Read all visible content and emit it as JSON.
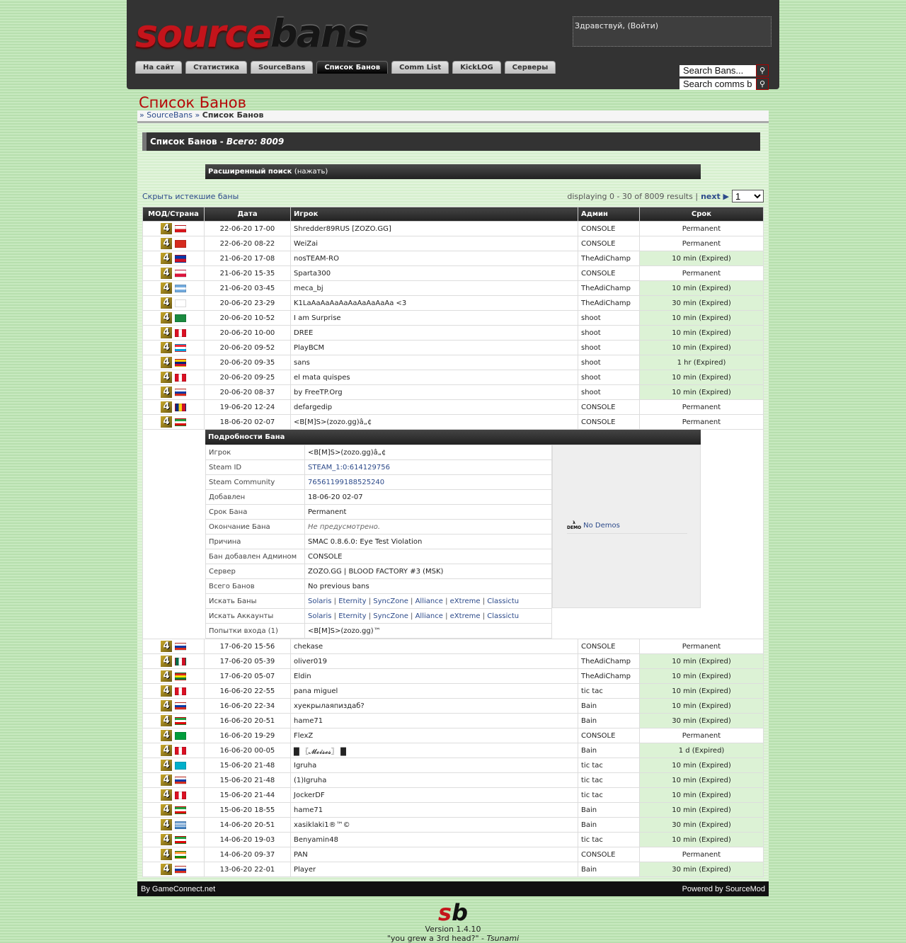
{
  "header": {
    "logo_part1": "source",
    "logo_part2": "bans",
    "welcome_text": "Здравствуй, ",
    "login_link": "(Войти)",
    "tabs": [
      {
        "label": "На сайт",
        "active": false
      },
      {
        "label": "Статистика",
        "active": false
      },
      {
        "label": "SourceBans",
        "active": false
      },
      {
        "label": "Список Банов",
        "active": true
      },
      {
        "label": "Comm List",
        "active": false
      },
      {
        "label": "KickLOG",
        "active": false
      },
      {
        "label": "Серверы",
        "active": false
      }
    ],
    "search_bans_value": "Search Bans...",
    "search_comms_value": "Search comms bans..."
  },
  "page": {
    "title": "Список Банов",
    "breadcrumb": {
      "sep": "»",
      "root": "SourceBans",
      "current": "Список Банов"
    },
    "list_title": "Список Банов - ",
    "list_total": "Всего: 8009",
    "adv_search_label": "Расширенный поиск",
    "adv_search_hint": "(нажать)",
    "hide_expired": "Скрыть истекшие баны",
    "pager_text": "displaying 0 - 30 of 8009 results |",
    "pager_next": "next ▶",
    "pager_page": "1"
  },
  "table": {
    "headers": [
      "МОД/Страна",
      "Дата",
      "Игрок",
      "Админ",
      "Срок"
    ],
    "rows_before": [
      {
        "flag": "cz",
        "date": "22-06-20 17-00",
        "player": "Shredder89RUS [ZOZO.GG]",
        "admin": "CONSOLE",
        "length": "Permanent",
        "expired": false
      },
      {
        "flag": "tw",
        "date": "22-06-20 08-22",
        "player": "WeiZai",
        "admin": "CONSOLE",
        "length": "Permanent",
        "expired": false
      },
      {
        "flag": "ph",
        "date": "21-06-20 17-08",
        "player": "nosTEAM-RO",
        "admin": "TheAdiChamp",
        "length": "10 min (Expired)",
        "expired": true
      },
      {
        "flag": "pl",
        "date": "21-06-20 15-35",
        "player": "Sparta300",
        "admin": "CONSOLE",
        "length": "Permanent",
        "expired": false
      },
      {
        "flag": "ar",
        "date": "21-06-20 03-45",
        "player": "meca_bj",
        "admin": "TheAdiChamp",
        "length": "10 min (Expired)",
        "expired": true
      },
      {
        "flag": "ge",
        "date": "20-06-20 23-29",
        "player": "K1LaAaAaAaAaAaAaAaAaAa <3",
        "admin": "TheAdiChamp",
        "length": "30 min (Expired)",
        "expired": true
      },
      {
        "flag": "tm",
        "date": "20-06-20 10-52",
        "player": "I am Surprise",
        "admin": "shoot",
        "length": "10 min (Expired)",
        "expired": true
      },
      {
        "flag": "pe",
        "date": "20-06-20 10-00",
        "player": "DREE",
        "admin": "shoot",
        "length": "10 min (Expired)",
        "expired": true
      },
      {
        "flag": "lu",
        "date": "20-06-20 09-52",
        "player": "PlayBCM",
        "admin": "shoot",
        "length": "10 min (Expired)",
        "expired": true
      },
      {
        "flag": "ve",
        "date": "20-06-20 09-35",
        "player": "sans",
        "admin": "shoot",
        "length": "1 hr (Expired)",
        "expired": true
      },
      {
        "flag": "pe",
        "date": "20-06-20 09-25",
        "player": "el mata quispes",
        "admin": "shoot",
        "length": "10 min (Expired)",
        "expired": true
      },
      {
        "flag": "ru",
        "date": "20-06-20 08-37",
        "player": "by FreeTP.Org",
        "admin": "shoot",
        "length": "10 min (Expired)",
        "expired": true
      },
      {
        "flag": "ro",
        "date": "19-06-20 12-24",
        "player": "defargedip",
        "admin": "CONSOLE",
        "length": "Permanent",
        "expired": false
      },
      {
        "flag": "ir",
        "date": "18-06-20 02-07",
        "player": "<B[M]S>(zozo.gg)â„¢",
        "admin": "CONSOLE",
        "length": "Permanent",
        "expired": false
      }
    ],
    "details": {
      "title": "Подробности Бана",
      "fields": [
        {
          "key": "Игрок",
          "value": "<B[M]S>(zozo.gg)â„¢"
        },
        {
          "key": "Steam ID",
          "value": "STEAM_1:0:614129756",
          "link": true
        },
        {
          "key": "Steam Community",
          "value": "76561199188525240",
          "link": true
        },
        {
          "key": "Добавлен",
          "value": "18-06-20 02-07"
        },
        {
          "key": "Срок Бана",
          "value": "Permanent"
        },
        {
          "key": "Окончание Бана",
          "value": "Не предусмотрено.",
          "italic": true
        },
        {
          "key": "Причина",
          "value": "SMAC 0.8.6.0: Eye Test Violation"
        },
        {
          "key": "Бан добавлен Админом",
          "value": "CONSOLE"
        },
        {
          "key": "Сервер",
          "value": "ZOZO.GG | BLOOD FACTORY #3 (MSK)"
        },
        {
          "key": "Всего Банов",
          "value": "No previous bans"
        }
      ],
      "search_bans_label": "Искать Баны",
      "search_accounts_label": "Искать Аккаунты",
      "search_links": [
        "Solaris",
        "Eternity",
        "SyncZone",
        "Alliance",
        "eXtreme",
        "Classictu"
      ],
      "login_attempts_label": "Попытки входа (1)",
      "login_attempts_value": "<B[M]S>(zozo.gg)™",
      "demo_label": "No Demos",
      "demo_icon_text": "DEMO"
    },
    "rows_after": [
      {
        "flag": "ru",
        "date": "17-06-20 15-56",
        "player": "chekase",
        "admin": "CONSOLE",
        "length": "Permanent",
        "expired": false
      },
      {
        "flag": "mx",
        "date": "17-06-20 05-39",
        "player": "oliver019",
        "admin": "TheAdiChamp",
        "length": "10 min (Expired)",
        "expired": true
      },
      {
        "flag": "bo",
        "date": "17-06-20 05-07",
        "player": "Eldin",
        "admin": "TheAdiChamp",
        "length": "10 min (Expired)",
        "expired": true
      },
      {
        "flag": "pe",
        "date": "16-06-20 22-55",
        "player": "pana miguel",
        "admin": "tic tac",
        "length": "10 min (Expired)",
        "expired": true
      },
      {
        "flag": "ru",
        "date": "16-06-20 22-34",
        "player": "хуекрылаяпиздаб?",
        "admin": "Bain",
        "length": "10 min (Expired)",
        "expired": true
      },
      {
        "flag": "ir",
        "date": "16-06-20 20-51",
        "player": "hame71",
        "admin": "Bain",
        "length": "30 min (Expired)",
        "expired": true
      },
      {
        "flag": "br",
        "date": "16-06-20 19-29",
        "player": "FlexZ",
        "admin": "CONSOLE",
        "length": "Permanent",
        "expired": false
      },
      {
        "flag": "pe",
        "date": "16-06-20 00-05",
        "player": "█ 〖𝓜𝓸𝓲𝓼𝓮𝓼〗 █",
        "admin": "Bain",
        "length": "1 d (Expired)",
        "expired": true
      },
      {
        "flag": "kz",
        "date": "15-06-20 21-48",
        "player": "Igruha",
        "admin": "tic tac",
        "length": "10 min (Expired)",
        "expired": true
      },
      {
        "flag": "ru",
        "date": "15-06-20 21-48",
        "player": "(1)Igruha",
        "admin": "tic tac",
        "length": "10 min (Expired)",
        "expired": true
      },
      {
        "flag": "pe",
        "date": "15-06-20 21-44",
        "player": "JockerDF",
        "admin": "tic tac",
        "length": "10 min (Expired)",
        "expired": true
      },
      {
        "flag": "ir",
        "date": "15-06-20 18-55",
        "player": "hame71",
        "admin": "Bain",
        "length": "10 min (Expired)",
        "expired": true
      },
      {
        "flag": "gr",
        "date": "14-06-20 20-51",
        "player": "xasiklaki1®™©",
        "admin": "Bain",
        "length": "30 min (Expired)",
        "expired": true
      },
      {
        "flag": "ir",
        "date": "14-06-20 19-03",
        "player": "Benyamin48",
        "admin": "tic tac",
        "length": "10 min (Expired)",
        "expired": true
      },
      {
        "flag": "in",
        "date": "14-06-20 09-37",
        "player": "PAN",
        "admin": "CONSOLE",
        "length": "Permanent",
        "expired": false
      },
      {
        "flag": "ru",
        "date": "13-06-20 22-01",
        "player": "Player",
        "admin": "Bain",
        "length": "30 min (Expired)",
        "expired": true
      }
    ]
  },
  "footer": {
    "left": "By GameConnect.net",
    "right": "Powered by SourceMod",
    "logo_s": "s",
    "logo_b": "b",
    "version": "Version 1.4.10",
    "quote": "\"you grew a 3rd head?\" - ",
    "quote_author": "Tsunami"
  },
  "colors": {
    "accent_red": "#b60808",
    "header_bg": "#333333",
    "expired_bg": "#dcf2d5",
    "link": "#2c4a8a"
  }
}
